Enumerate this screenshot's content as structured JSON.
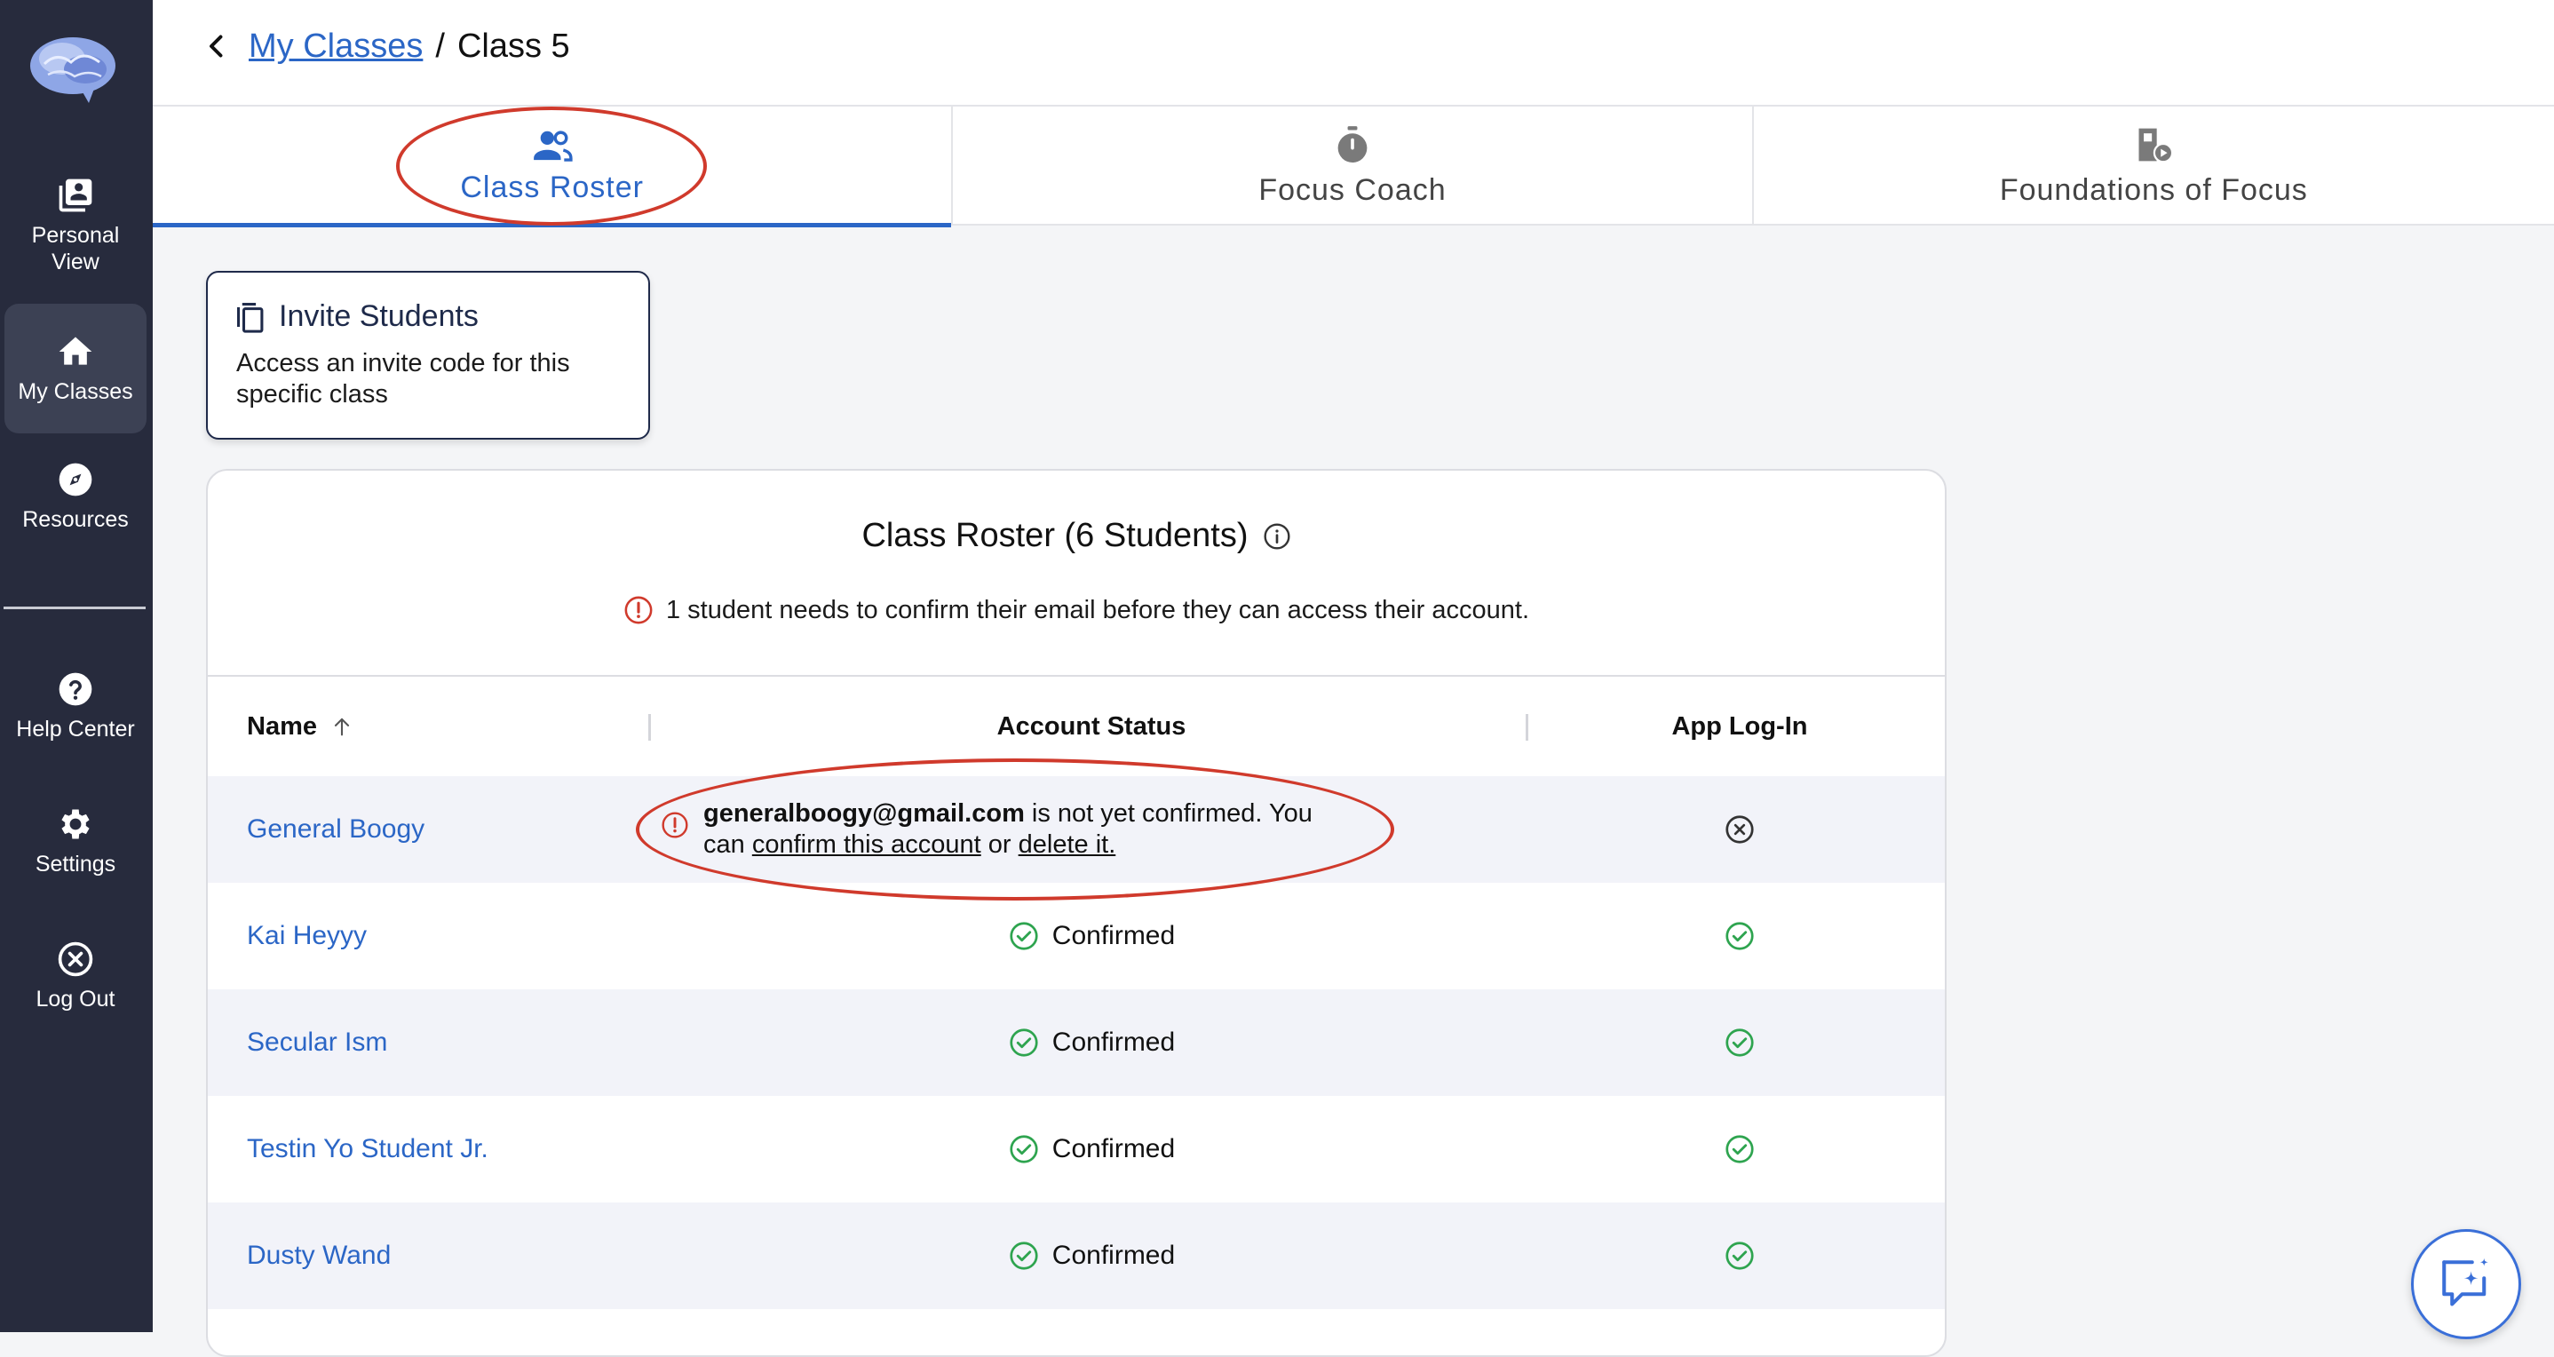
{
  "sidebar": {
    "items": [
      {
        "label": "Personal View",
        "icon": "person-view-icon"
      },
      {
        "label": "My Classes",
        "icon": "home-icon",
        "active": true
      },
      {
        "label": "Resources",
        "icon": "compass-icon"
      },
      {
        "label": "Help Center",
        "icon": "help-icon"
      },
      {
        "label": "Settings",
        "icon": "gear-icon"
      },
      {
        "label": "Log Out",
        "icon": "logout-icon"
      }
    ]
  },
  "breadcrumb": {
    "parent": "My Classes",
    "separator": "/",
    "current": "Class 5"
  },
  "tabs": [
    {
      "label": "Class Roster",
      "icon": "people-icon",
      "active": true
    },
    {
      "label": "Focus Coach",
      "icon": "stopwatch-icon"
    },
    {
      "label": "Foundations of Focus",
      "icon": "video-lesson-icon"
    }
  ],
  "invite": {
    "title": "Invite Students",
    "description": "Access an invite code for this specific class"
  },
  "roster": {
    "title": "Class Roster (6 Students)",
    "warning": "1 student needs to confirm their email before they can access their account.",
    "columns": {
      "name": "Name",
      "status": "Account Status",
      "login": "App Log-In"
    },
    "unconfirmed": {
      "email": "generalboogy@gmail.com",
      "text1": " is not yet confirmed. You",
      "text2": "can ",
      "confirm_link": "confirm this account",
      "text3": " or ",
      "delete_link": "delete it."
    },
    "rows": [
      {
        "name": "General Boogy",
        "status": "unconfirmed",
        "login": false
      },
      {
        "name": "Kai Heyyy",
        "status": "Confirmed",
        "login": true
      },
      {
        "name": "Secular Ism",
        "status": "Confirmed",
        "login": true
      },
      {
        "name": "Testin Yo Student Jr.",
        "status": "Confirmed",
        "login": true
      },
      {
        "name": "Dusty Wand",
        "status": "Confirmed",
        "login": true
      }
    ]
  },
  "colors": {
    "sidebar_bg": "#272b3d",
    "accent": "#2b66c6",
    "success": "#2ea44f",
    "danger": "#d03a2c"
  }
}
